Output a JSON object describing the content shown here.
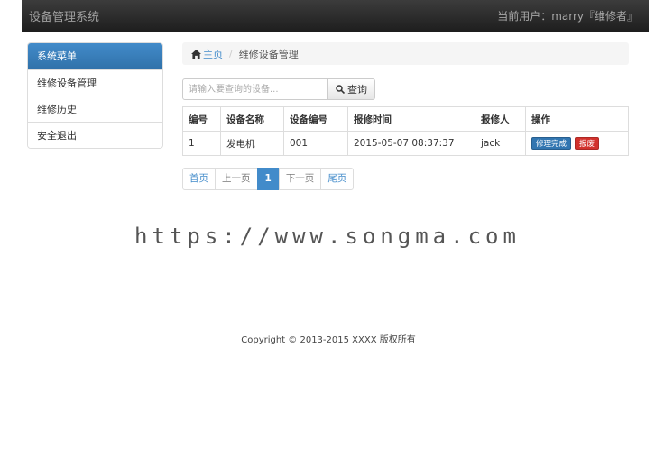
{
  "navbar": {
    "brand": "设备管理系统",
    "user": "当前用户：marry『维修者』"
  },
  "sidebar": {
    "header": "系统菜单",
    "items": [
      {
        "label": "维修设备管理"
      },
      {
        "label": "维修历史"
      },
      {
        "label": "安全退出"
      }
    ]
  },
  "breadcrumb": {
    "home": "主页",
    "current": "维修设备管理"
  },
  "search": {
    "placeholder": "请输入要查询的设备...",
    "button": "查询"
  },
  "table": {
    "headers": [
      "编号",
      "设备名称",
      "设备编号",
      "报修时间",
      "报修人",
      "操作"
    ],
    "rows": [
      {
        "id": "1",
        "name": "发电机",
        "code": "001",
        "time": "2015-05-07 08:37:37",
        "reporter": "jack",
        "action_primary": "修理完成",
        "action_danger": "报废"
      }
    ]
  },
  "pagination": {
    "first": "首页",
    "prev": "上一页",
    "current": "1",
    "next": "下一页",
    "last": "尾页"
  },
  "watermark": "https://www.songma.com",
  "footer": "Copyright © 2013-2015 XXXX 版权所有",
  "colors": {
    "primary": "#428bca",
    "danger": "#d2322d",
    "navbar": "#222222"
  }
}
